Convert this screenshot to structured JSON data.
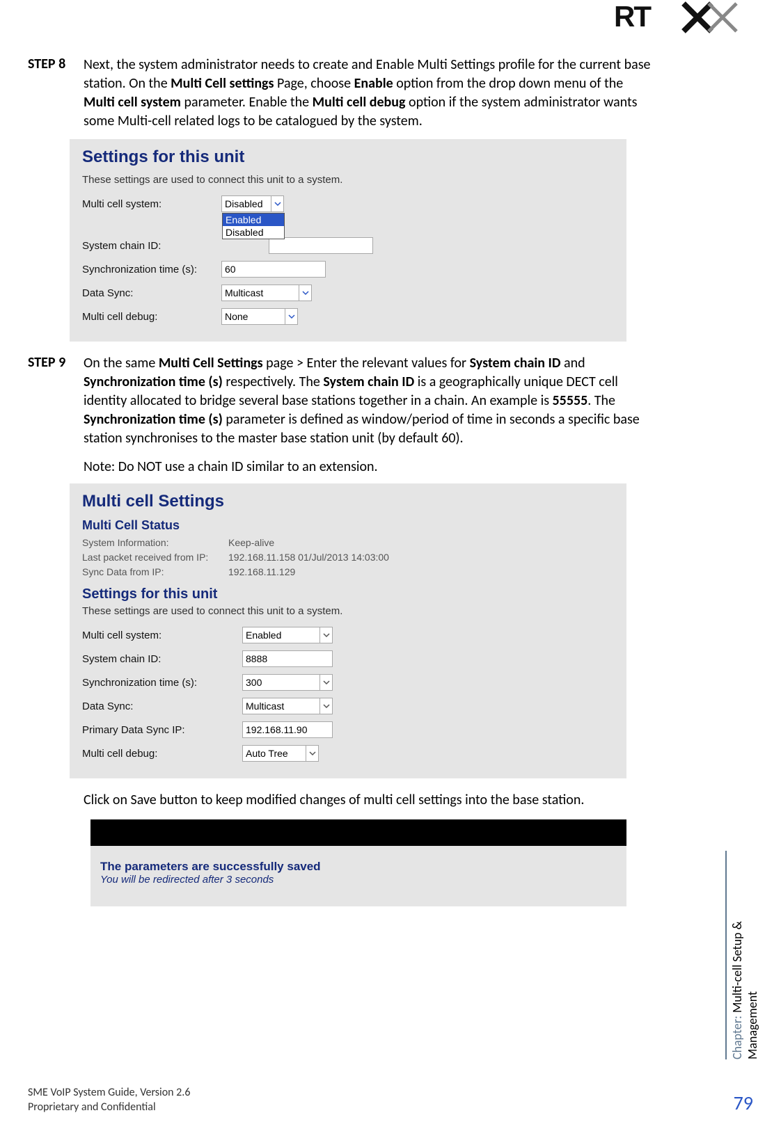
{
  "header": {
    "logo_text": "RTX"
  },
  "step8": {
    "label": "STEP 8",
    "p1a": "Next, the system administrator needs to create and Enable Multi Settings profile for the current base station. On the ",
    "p1b": "Multi Cell settings",
    "p1c": " Page, choose ",
    "p1d": "Enable",
    "p1e": " option from the drop down menu of the ",
    "p1f": "Multi cell system",
    "p1g": " parameter. Enable the ",
    "p1h": "Multi cell debug",
    "p1i": " option if the system administrator wants some Multi-cell related logs to be catalogued by the system."
  },
  "panel1": {
    "title": "Settings for this unit",
    "desc": "These settings are used to connect this unit to a system.",
    "rows": {
      "r0_label": "Multi cell system:",
      "r0_value": "Disabled",
      "r0_opt_sel": "Enabled",
      "r0_opt_other": "Disabled",
      "r1_label": "System chain ID:",
      "r1_value": "",
      "r2_label": "Synchronization time (s):",
      "r2_value": "60",
      "r3_label": "Data Sync:",
      "r3_value": "Multicast",
      "r4_label": "Multi cell debug:",
      "r4_value": "None"
    }
  },
  "step9": {
    "label": "STEP 9",
    "p1a": "On the same ",
    "p1b": "Multi Cell Settings",
    "p1c": " page > Enter the relevant values for ",
    "p1d": "System chain ID",
    "p1e": " and ",
    "p1f": "Synchronization time (s)",
    "p1g": " respectively. The ",
    "p1h": "System chain ID",
    "p1i": " is a geographically unique DECT cell identity allocated to bridge several base stations together in a chain. An example is ",
    "p1j": "55555",
    "p1k": ". The ",
    "p1l": "Synchronization time (s)",
    "p1m": " parameter is defined as window/period of time in seconds a specific base station synchronises to the master base station unit (by default 60).",
    "note": "Note: Do NOT use a chain ID similar to an extension."
  },
  "panel2": {
    "title": "Multi cell Settings",
    "status_title": "Multi Cell Status",
    "status": {
      "s0_label": "System Information:",
      "s0_value": "Keep-alive",
      "s1_label": "Last packet received from IP:",
      "s1_value": "192.168.11.158 01/Jul/2013 14:03:00",
      "s2_label": "Sync Data from IP:",
      "s2_value": "192.168.11.129"
    },
    "settings_title": "Settings for this unit",
    "desc": "These settings are used to connect this unit to a system.",
    "rows": {
      "r0_label": "Multi cell system:",
      "r0_value": "Enabled",
      "r1_label": "System chain ID:",
      "r1_value": "8888",
      "r2_label": "Synchronization time (s):",
      "r2_value": "300",
      "r3_label": "Data Sync:",
      "r3_value": "Multicast",
      "r4_label": "Primary Data Sync IP:",
      "r4_value": "192.168.11.90",
      "r5_label": "Multi cell debug:",
      "r5_value": "Auto Tree"
    }
  },
  "after_panel2": {
    "a": "Click on ",
    "b": "Save",
    "c": " button to keep modified changes of multi cell settings into the base station."
  },
  "save_panel": {
    "line1": "The parameters are successfully saved",
    "line2": "You will be redirected after 3 seconds"
  },
  "side": {
    "chapter_prefix": "Chapter: ",
    "chapter_name": "Multi-cell Setup & Management"
  },
  "footer": {
    "line1": "SME VoIP System Guide, Version 2.6",
    "line2": "Proprietary and Confidential",
    "page": "79"
  }
}
